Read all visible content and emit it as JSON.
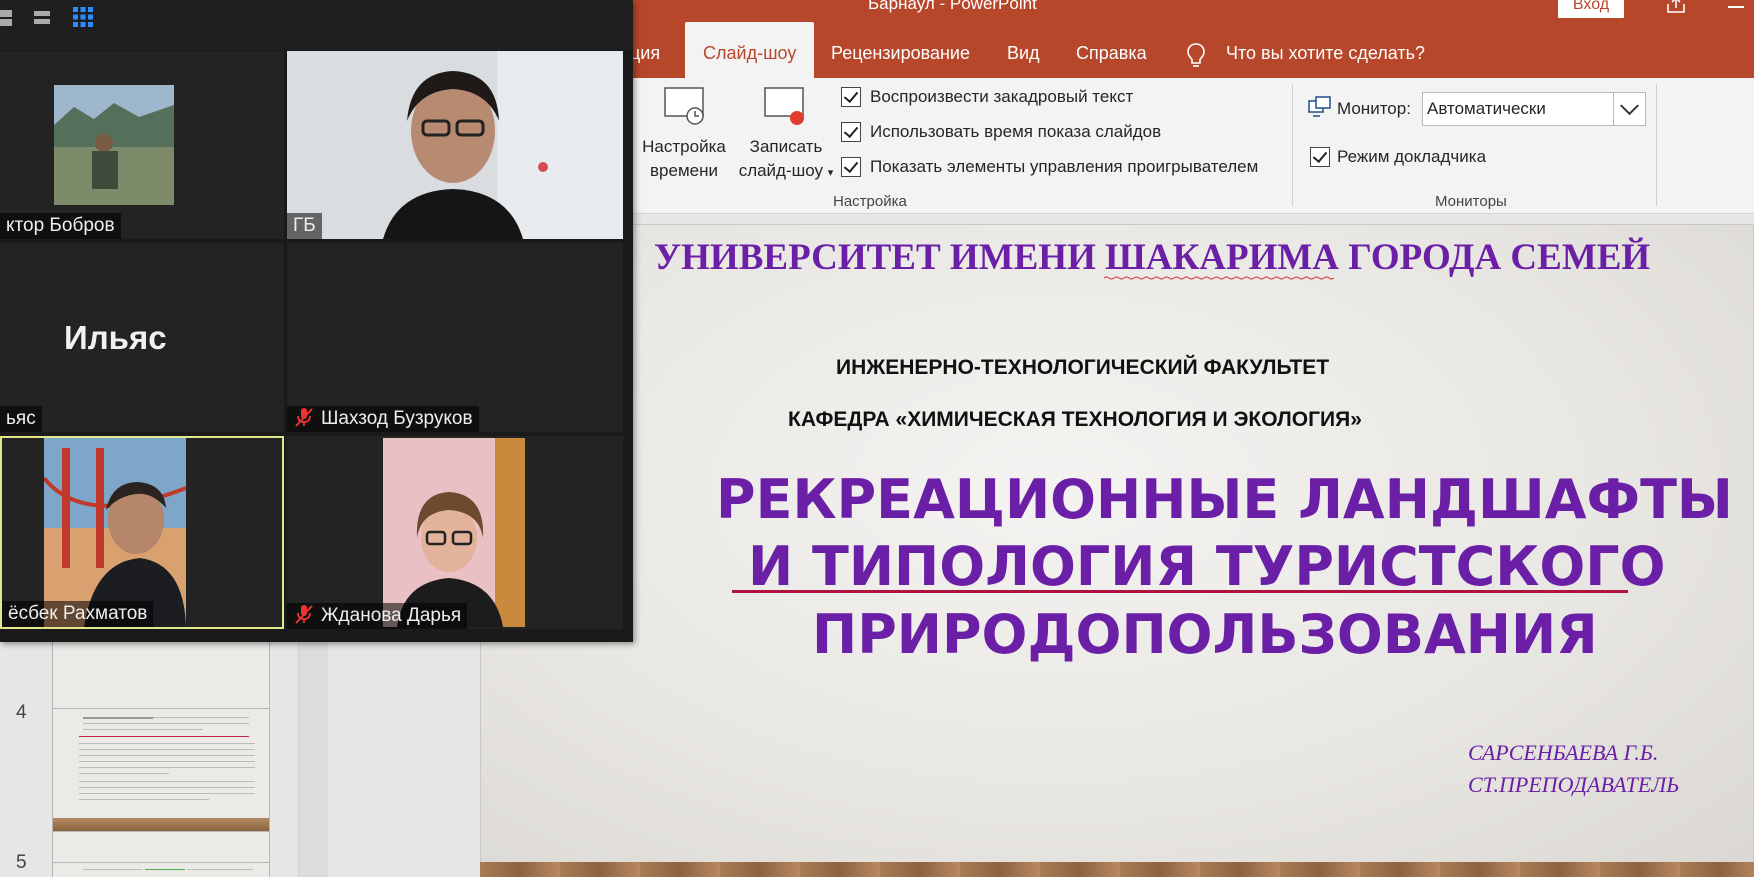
{
  "window": {
    "title": "Барнаул  -  PowerPoint",
    "login_label": "Вход"
  },
  "ribbon": {
    "tabs": [
      {
        "label": "ция"
      },
      {
        "label": "Слайд-шоу"
      },
      {
        "label": "Рецензирование"
      },
      {
        "label": "Вид"
      },
      {
        "label": "Справка"
      },
      {
        "label": "Что вы хотите сделать?"
      }
    ],
    "setup": {
      "rehearse_l1": "Настройка",
      "rehearse_l2": "времени",
      "record_l1": "Записать",
      "record_l2": "слайд-шоу",
      "checkboxes": [
        {
          "label": "Воспроизвести закадровый текст",
          "checked": true
        },
        {
          "label": "Использовать время показа слайдов",
          "checked": true
        },
        {
          "label": "Показать элементы управления проигрывателем",
          "checked": true
        }
      ],
      "group_label": "Настройка"
    },
    "monitors": {
      "monitor_label": "Монитор:",
      "monitor_value": "Автоматически",
      "presenter_label": "Режим докладчика",
      "presenter_checked": true,
      "group_label": "Мониторы"
    }
  },
  "thumbnails": [
    {
      "number": "4"
    },
    {
      "number": "5"
    }
  ],
  "slide": {
    "university": "УНИВЕРСИТЕТ ИМЕНИ ШАКАРИМА ГОРОДА СЕМЕЙ",
    "faculty": "ИНЖЕНЕРНО-ТЕХНОЛОГИЧЕСКИЙ ФАКУЛЬТЕТ",
    "department": "КАФЕДРА «ХИМИЧЕСКАЯ ТЕХНОЛОГИЯ И ЭКОЛОГИЯ»",
    "title_line1": "РЕКРЕАЦИОННЫЕ ЛАНДШАФТЫ",
    "title_line2": "И  ТИПОЛОГИЯ ТУРИСТСКОГО",
    "title_line3": "ПРИРОДОПОЛЬЗОВАНИЯ",
    "author": "САРСЕНБАЕВА Г.Б.",
    "position": "СТ.ПРЕПОДАВАТЕЛЬ",
    "title_color": "#6a1fa6"
  },
  "participants": [
    {
      "name": "ктор Бобров",
      "muted": false
    },
    {
      "name": "ГБ",
      "muted": false
    },
    {
      "name": "ьяс",
      "display": "Ильяс",
      "muted": false
    },
    {
      "name": "Шахзод Бузруков",
      "muted": true
    },
    {
      "name": "ёсбек Рахматов",
      "muted": false,
      "active_speaker": true
    },
    {
      "name": "Жданова Дарья",
      "muted": true
    }
  ],
  "colors": {
    "ppt_accent": "#b7472a",
    "zoom_bg": "#1a1a1a",
    "active_border": "#e2e88a"
  }
}
